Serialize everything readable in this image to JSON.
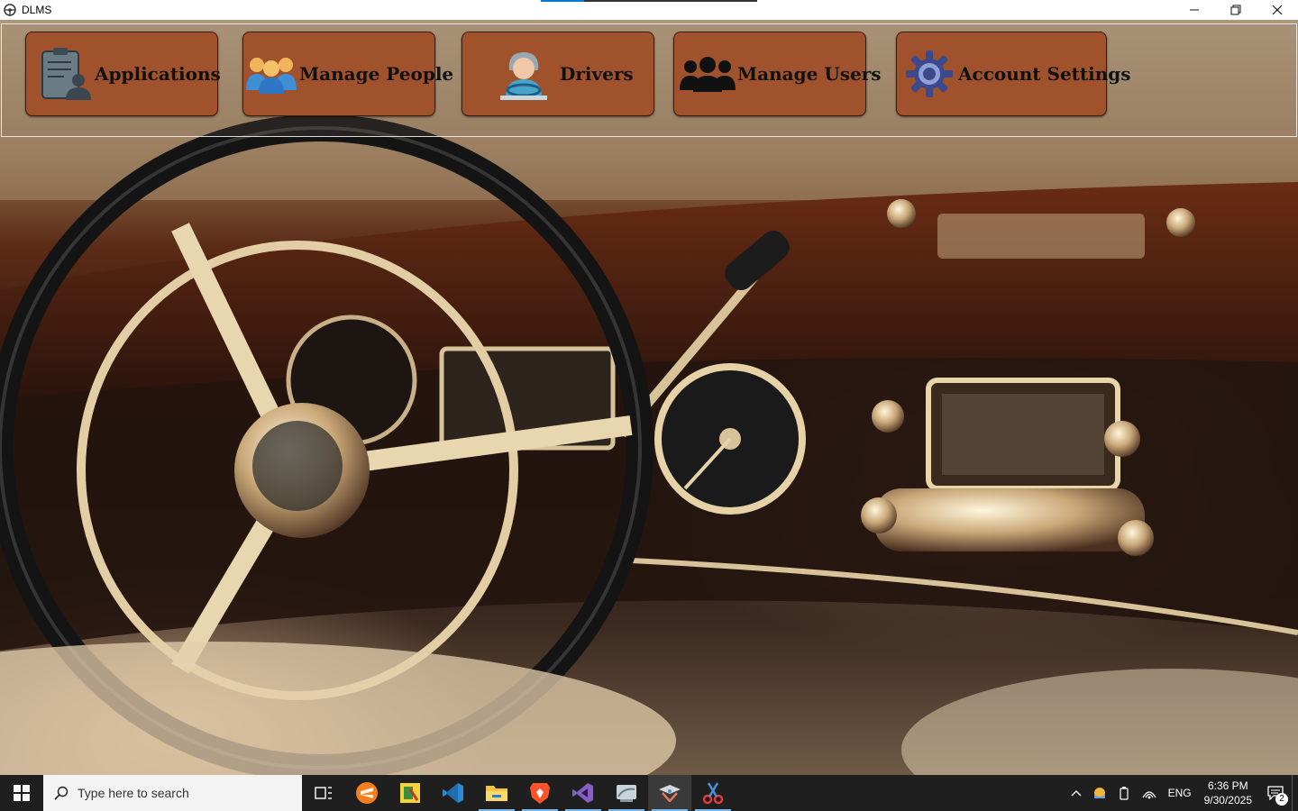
{
  "window": {
    "title": "DLMS",
    "controls": {
      "minimize": "—",
      "maximize": "❐",
      "close": "✕"
    }
  },
  "toolbar": {
    "buttons": [
      {
        "label": "Applications",
        "icon": "clipboard-person-icon"
      },
      {
        "label": "Manage People",
        "icon": "people-group-icon"
      },
      {
        "label": "Drivers",
        "icon": "driver-icon"
      },
      {
        "label": "Manage Users",
        "icon": "users-icon"
      },
      {
        "label": "Account Settings",
        "icon": "gear-icon"
      }
    ],
    "button_color": "#a0522d"
  },
  "taskbar": {
    "search_placeholder": "Type here to search",
    "apps": [
      "task-view-icon",
      "sublime-text-icon",
      "git-gui-icon",
      "vscode-icon",
      "file-explorer-icon",
      "brave-icon",
      "visual-studio-icon",
      "ssms-icon",
      "dlms-app-icon",
      "snipping-tool-icon"
    ],
    "tray": {
      "language": "ENG",
      "time": "6:36 PM",
      "date": "9/30/2025",
      "notification_count": "2"
    }
  }
}
